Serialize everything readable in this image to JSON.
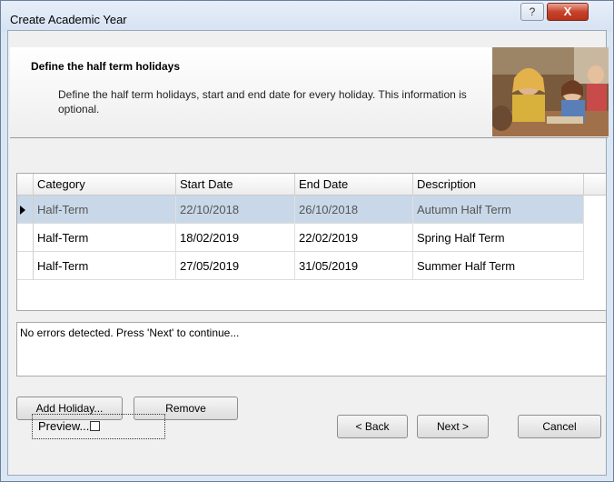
{
  "window": {
    "title": "Create Academic Year",
    "help_glyph": "?",
    "close_glyph": "X"
  },
  "header": {
    "title": "Define the half term holidays",
    "description": "Define the half term holidays, start and end date for every holiday. This information is optional."
  },
  "grid": {
    "columns": [
      "Category",
      "Start Date",
      "End Date",
      "Description"
    ],
    "rows": [
      {
        "category": "Half-Term",
        "start": "22/10/2018",
        "end": "26/10/2018",
        "description": "Autumn Half Term",
        "selected": true
      },
      {
        "category": "Half-Term",
        "start": "18/02/2019",
        "end": "22/02/2019",
        "description": "Spring Half Term",
        "selected": false
      },
      {
        "category": "Half-Term",
        "start": "27/05/2019",
        "end": "31/05/2019",
        "description": "Summer Half Term",
        "selected": false
      }
    ]
  },
  "status": {
    "message": "No errors detected. Press 'Next' to continue..."
  },
  "actions": {
    "add_holiday": "Add Holiday...",
    "remove": "Remove"
  },
  "footer": {
    "preview": "Preview...",
    "preview_checked": false,
    "back": "< Back",
    "next": "Next >",
    "cancel": "Cancel"
  },
  "icons": {
    "row_indicator": "current-row-arrow-icon",
    "header_image": "classroom-photo"
  }
}
